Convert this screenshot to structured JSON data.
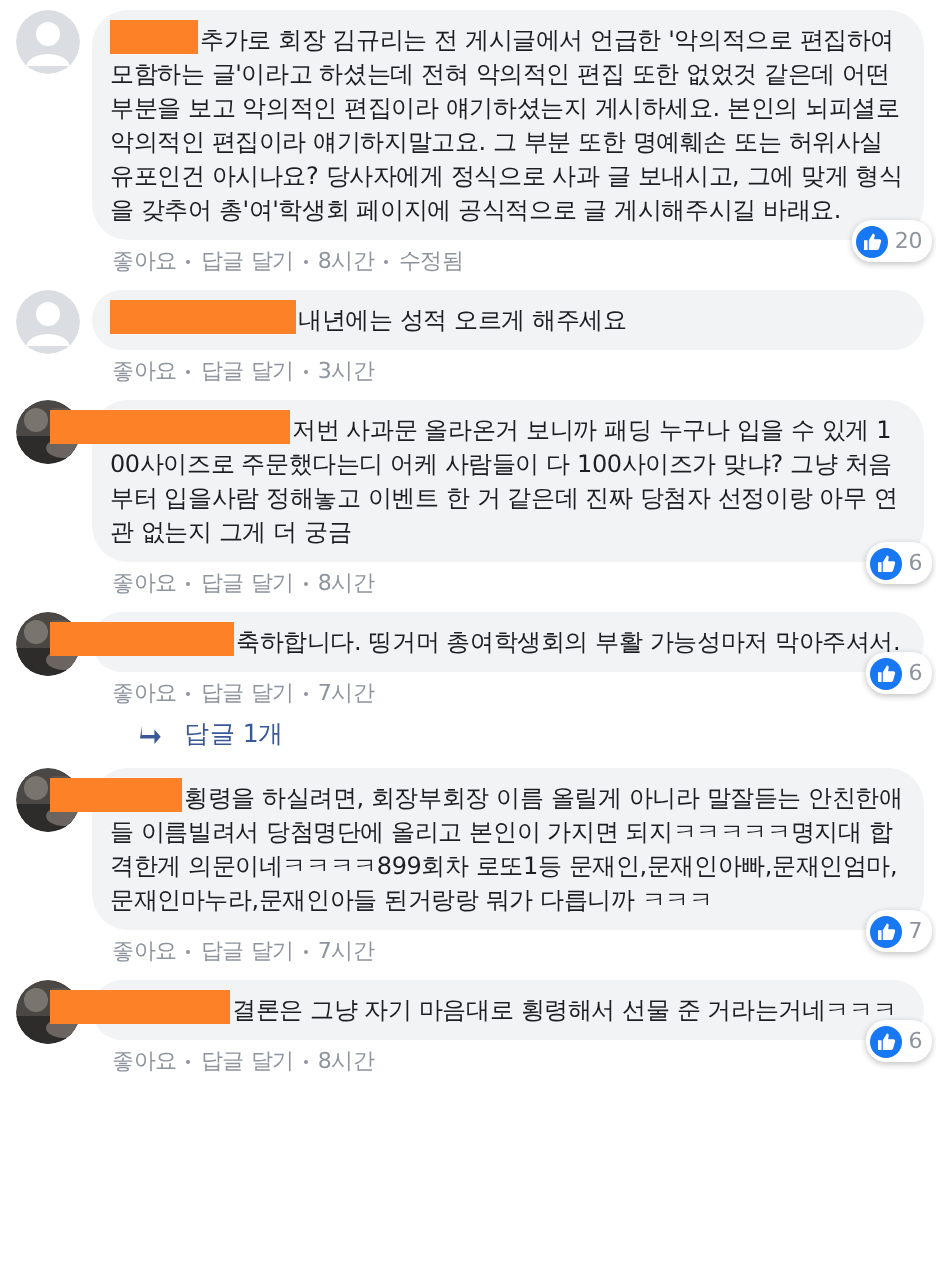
{
  "comments": [
    {
      "kind": "default",
      "name_redacted": true,
      "text": "추가로 회장 김규리는 전 게시글에서 언급한 '악의적으로 편집하여 모함하는 글'이라고 하셨는데 전혀 악의적인 편집 또한 없었것 같은데 어떤 부분을 보고 악의적인 편집이라 얘기하셨는지 게시하세요. 본인의 뇌피셜로 악의적인 편집이라 얘기하지말고요. 그 부분 또한 명예훼손 또는 허위사실유포인건 아시나요? 당사자에게 정식으로 사과 글 보내시고, 그에 맞게 형식을 갖추어 총'여'학생회 페이지에 공식적으로 글 게시해주시길 바래요.",
      "actions": [
        "좋아요",
        "답글 달기",
        "8시간",
        "수정됨"
      ],
      "likes": "20"
    },
    {
      "kind": "default",
      "name_redacted": true,
      "text": "내년에는 성적 오르게 해주세요",
      "actions": [
        "좋아요",
        "답글 달기",
        "3시간"
      ]
    },
    {
      "kind": "picture",
      "name_redacted": true,
      "text": "저번 사과문 올라온거 보니까 패딩 누구나 입을 수 있게 100사이즈로 주문했다는디 어케 사람들이 다 100사이즈가 맞냐? 그냥 처음부터 입을사람 정해놓고 이벤트 한 거 같은데 진짜 당첨자 선정이랑 아무 연관 없는지 그게 더 궁금",
      "actions": [
        "좋아요",
        "답글 달기",
        "8시간"
      ],
      "likes": "6"
    },
    {
      "kind": "picture",
      "name_redacted": true,
      "text": "축하합니다. 띵거머 총여학생회의 부활 가능성마저 막아주셔서.",
      "actions": [
        "좋아요",
        "답글 달기",
        "7시간"
      ],
      "likes": "6",
      "replies": "답글 1개"
    },
    {
      "kind": "picture",
      "name_redacted": true,
      "text": "횡령을 하실려면, 회장부회장 이름 올릴게 아니라 말잘듣는 안친한애들 이름빌려서 당첨명단에 올리고 본인이 가지면 되지ㅋㅋㅋㅋㅋ명지대 합격한게 의문이네ㅋㅋㅋㅋ899회차 로또1등 문재인,문재인아빠,문재인엄마,문재인마누라,문재인아들 된거랑랑 뭐가 다릅니까 ㅋㅋㅋ",
      "actions": [
        "좋아요",
        "답글 달기",
        "7시간"
      ],
      "likes": "7"
    },
    {
      "kind": "picture",
      "name_redacted": true,
      "text": "결론은 그냥 자기 마음대로 횡령해서 선물 준 거라는거네ㅋㅋㅋ",
      "actions": [
        "좋아요",
        "답글 달기",
        "8시간"
      ],
      "likes": "6"
    }
  ]
}
